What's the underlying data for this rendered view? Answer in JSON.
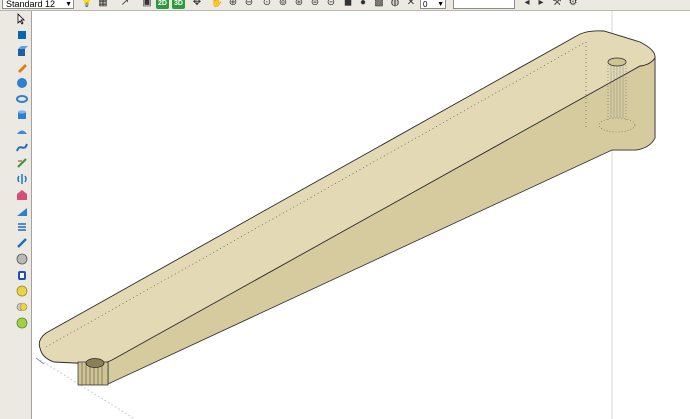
{
  "toolbar": {
    "style_select": "Standard 12",
    "btn_2d": "2D",
    "btn_3d": "3D",
    "num_value": "0"
  },
  "icons": [
    "pointer-icon",
    "select-icon",
    "box-icon",
    "cube-icon",
    "pencil-icon",
    "sphere-icon",
    "cone-icon",
    "torus-icon",
    "cylinder-icon",
    "extrude-icon",
    "sweep-icon",
    "pipe-icon",
    "revolve-icon",
    "bevel-icon",
    "wedge-icon",
    "thread-icon",
    "boolean-icon",
    "ellipse-icon",
    "union-icon",
    "subtract-icon",
    "intersect-icon"
  ],
  "colors": {
    "part_top": "#e2d8b2",
    "part_side": "#d7cc9f",
    "part_end": "#c9bd8c",
    "edge": "#2a2a2a",
    "accent_green": "#2e9a3c"
  }
}
